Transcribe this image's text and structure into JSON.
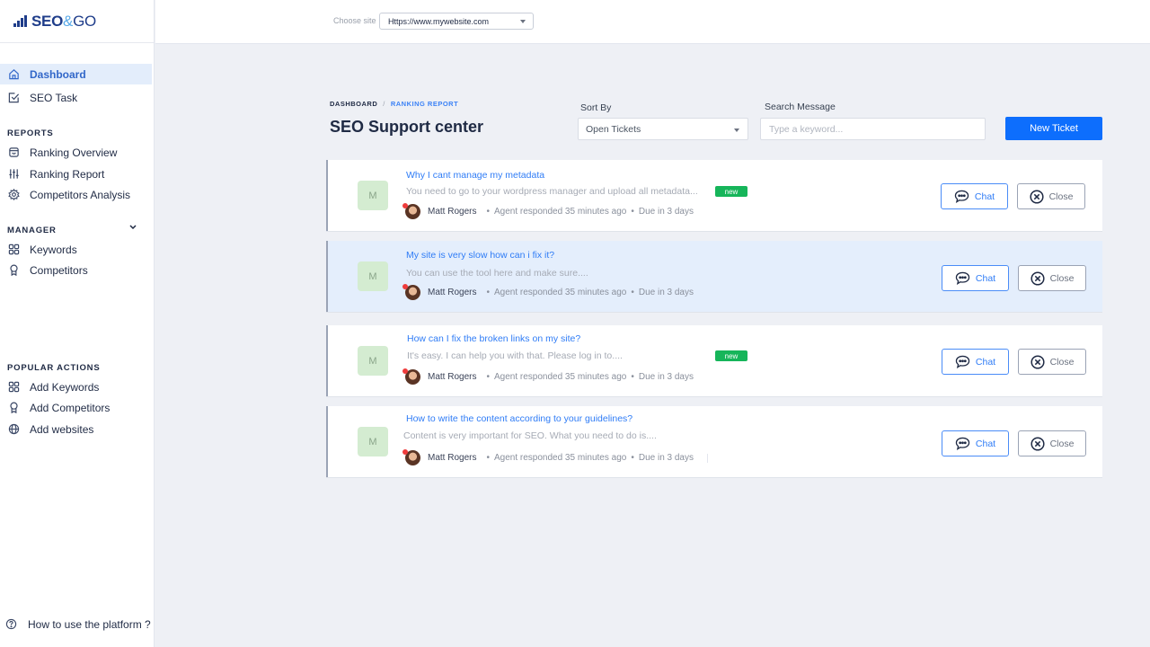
{
  "app": {
    "brand_main": "SEO",
    "brand_amp": "&",
    "brand_end": "GO"
  },
  "topbar": {
    "choose_site_label": "Choose site",
    "site_value": "Https://www.mywebsite.com"
  },
  "sidebar": {
    "top_items": [
      {
        "label": "Dashboard",
        "icon": "home-icon",
        "active": true
      },
      {
        "label": "SEO Task",
        "icon": "checkbox-icon",
        "active": false
      }
    ],
    "reports_title": "REPORTS",
    "reports_items": [
      {
        "label": "Ranking Overview",
        "icon": "inbox-icon"
      },
      {
        "label": "Ranking Report",
        "icon": "sliders-icon"
      },
      {
        "label": "Competitors Analysis",
        "icon": "gear-icon"
      }
    ],
    "manager_title": "MANAGER",
    "manager_items": [
      {
        "label": "Keywords",
        "icon": "grid-icon"
      },
      {
        "label": "Competitors",
        "icon": "award-icon"
      }
    ],
    "popular_title": "POPULAR ACTIONS",
    "popular_items": [
      {
        "label": "Add Keywords",
        "icon": "grid-icon"
      },
      {
        "label": "Add Competitors",
        "icon": "award-icon"
      },
      {
        "label": "Add websites",
        "icon": "globe-icon"
      }
    ],
    "help_label": "How to use the platform ?"
  },
  "header": {
    "breadcrumb_root": "DASHBOARD",
    "breadcrumb_sep": "/",
    "breadcrumb_current": "RANKING REPORT",
    "title": "SEO Support center",
    "sort_label": "Sort By",
    "sort_value": "Open Tickets",
    "search_label": "Search Message",
    "search_placeholder": "Type a keyword...",
    "search_value": "",
    "new_ticket_label": "New Ticket"
  },
  "tickets": [
    {
      "initial": "M",
      "title": "Why I cant manage my metadata",
      "message": "You need to go to your wordpress manager and upload all metadata...",
      "is_new": true,
      "badge": "new",
      "user": "Matt Rogers",
      "responded": "Agent responded 35 minutes ago",
      "due": "Due in 3 days",
      "highlighted": false
    },
    {
      "initial": "M",
      "title": "My site is very slow how can i fix it?",
      "message": "You can use the tool here and make sure....",
      "is_new": false,
      "badge": "",
      "user": "Matt Rogers",
      "responded": "Agent responded 35 minutes ago",
      "due": "Due in 3 days",
      "highlighted": true
    },
    {
      "initial": "M",
      "title": "How can I fix the broken links on my site?",
      "message": "It's easy. I can help you with that. Please log in to....",
      "is_new": true,
      "badge": "new",
      "user": "Matt Rogers",
      "responded": "Agent responded 35 minutes ago",
      "due": "Due in 3 days",
      "highlighted": false
    },
    {
      "initial": "M",
      "title": "How to write the content according to your guidelines?",
      "message": "Content is very important for SEO. What you need to do is....",
      "is_new": false,
      "badge": "",
      "user": "Matt Rogers",
      "responded": "Agent responded 35 minutes ago",
      "due": "Due in 3 days",
      "highlighted": false
    }
  ],
  "ticket_actions": {
    "chat_label": "Chat",
    "close_label": "Close"
  },
  "colors": {
    "accent": "#0d6efd",
    "link": "#2f7cf6",
    "new_badge": "#16b55a",
    "highlight_row": "#e4eefc"
  }
}
